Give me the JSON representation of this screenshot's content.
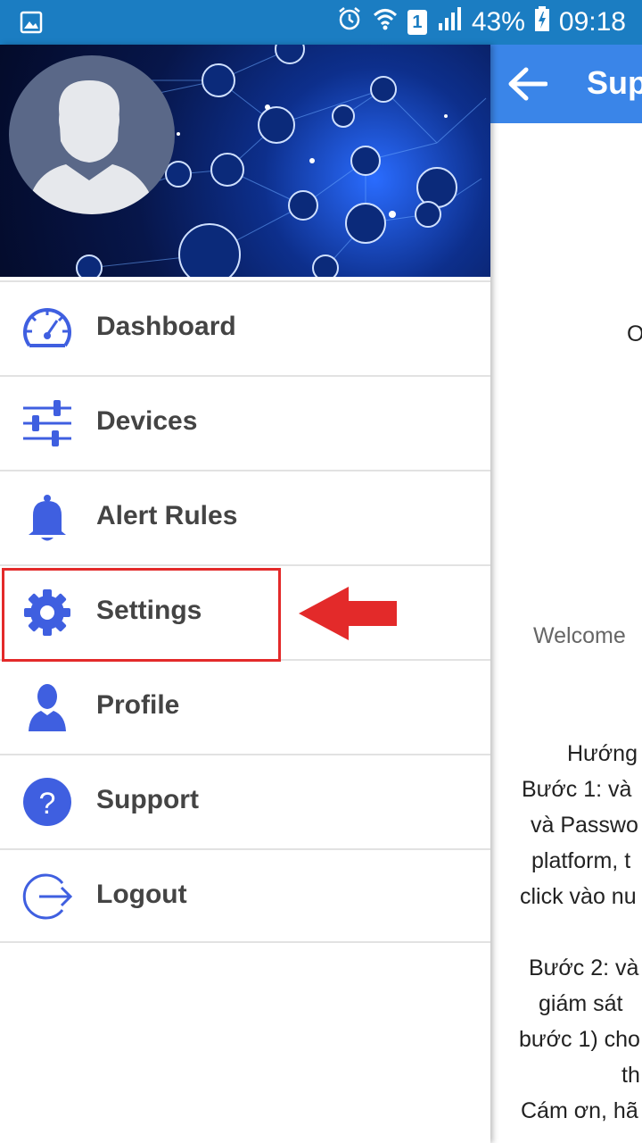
{
  "status_bar": {
    "battery": "43%",
    "time": "09:18",
    "sim": "1"
  },
  "page": {
    "title": "Sup",
    "lines": [
      "O",
      "Welcome",
      "Hướng",
      "Bước 1: và",
      "và Passwo",
      "platform, t",
      "click vào nu",
      "Bước 2: và",
      "giám sát",
      "bước 1) cho",
      "th",
      "Cám ơn, hã"
    ]
  },
  "drawer": {
    "menu": [
      {
        "label": "Dashboard",
        "icon": "dashboard-gauge-icon"
      },
      {
        "label": "Devices",
        "icon": "sliders-icon"
      },
      {
        "label": "Alert Rules",
        "icon": "bell-icon"
      },
      {
        "label": "Settings",
        "icon": "gear-icon"
      },
      {
        "label": "Profile",
        "icon": "person-icon"
      },
      {
        "label": "Support",
        "icon": "question-circle-icon"
      },
      {
        "label": "Logout",
        "icon": "logout-icon"
      }
    ]
  },
  "colors": {
    "status_bar": "#1b7dc2",
    "app_bar": "#3a85e8",
    "icon_blue": "#3f5fe0",
    "highlight_red": "#e32a2a"
  }
}
